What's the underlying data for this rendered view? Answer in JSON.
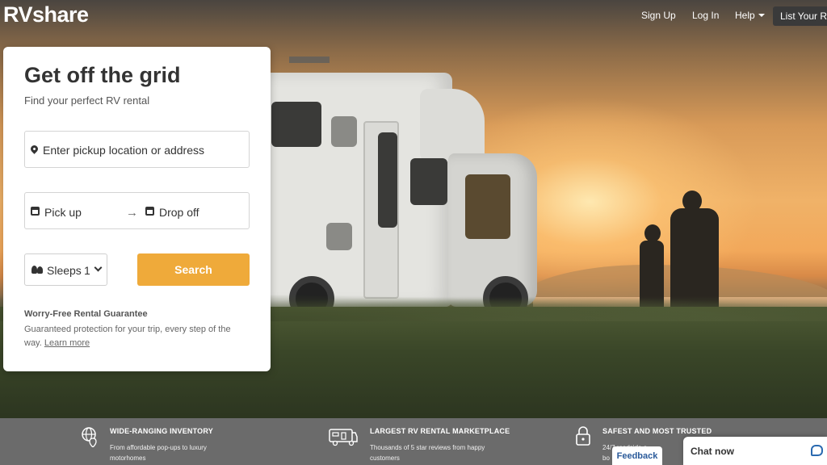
{
  "brand": {
    "logo": "RVshare"
  },
  "nav": {
    "sign_up": "Sign Up",
    "log_in": "Log In",
    "help": "Help",
    "list_rv": "List Your RV"
  },
  "search_card": {
    "title": "Get off the grid",
    "subtitle": "Find your perfect RV rental",
    "location_placeholder": "Enter pickup location or address",
    "pickup_label": "Pick up",
    "dropoff_label": "Drop off",
    "sleeps_label": "Sleeps",
    "sleeps_value": "1",
    "search_button": "Search",
    "guarantee_title": "Worry-Free Rental Guarantee",
    "guarantee_text": "Guaranteed protection for your trip, every step of the way.",
    "learn_more": "Learn more"
  },
  "features": [
    {
      "icon": "globe-pin-icon",
      "title": "WIDE-RANGING INVENTORY",
      "desc": "From affordable pop-ups to luxury motorhomes"
    },
    {
      "icon": "rv-icon",
      "title": "LARGEST RV RENTAL MARKETPLACE",
      "desc": "Thousands of 5 star reviews from happy customers"
    },
    {
      "icon": "lock-icon",
      "title": "SAFEST AND MOST TRUSTED",
      "desc": "24/7 roadside a"
    }
  ],
  "feature3_desc_line2": "bo",
  "widgets": {
    "feedback": "Feedback",
    "chat": "Chat now"
  },
  "colors": {
    "accent": "#efaa3a",
    "band": "#6b6b6b",
    "card": "#ffffff",
    "link_blue": "#2a5a9a"
  }
}
